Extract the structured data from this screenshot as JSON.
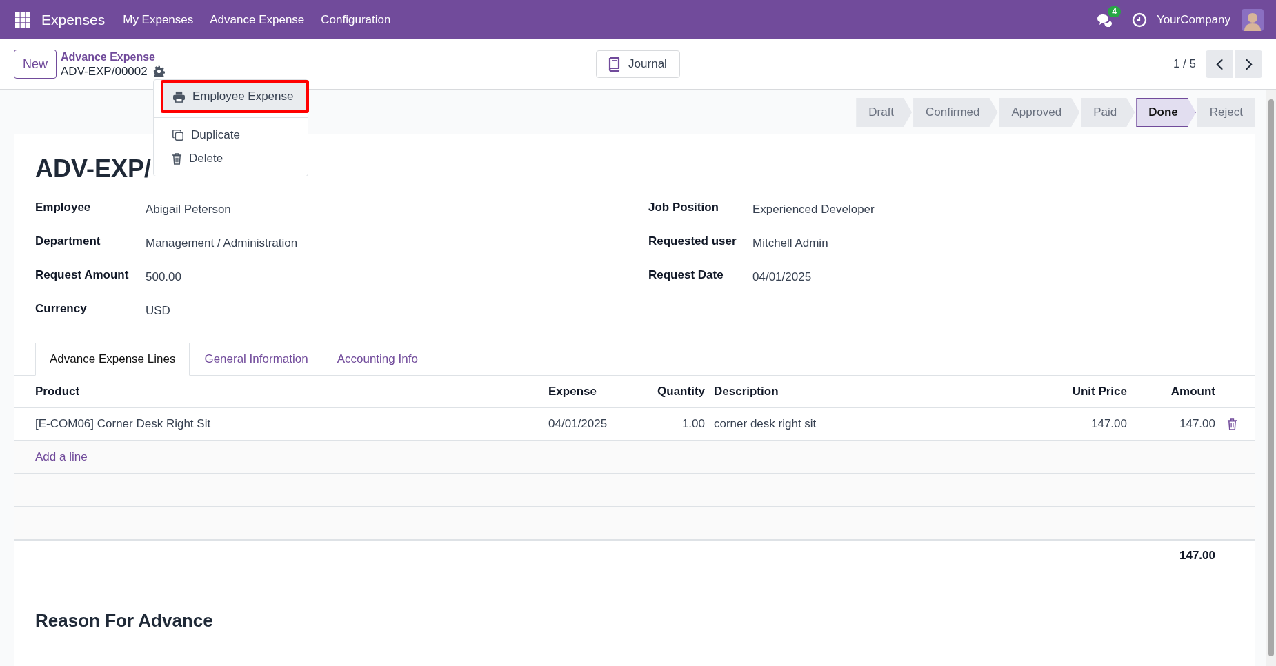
{
  "navbar": {
    "app_name": "Expenses",
    "menu": [
      "My Expenses",
      "Advance Expense",
      "Configuration"
    ],
    "messages_count": "4",
    "company": "YourCompany"
  },
  "control_panel": {
    "new_button": "New",
    "breadcrumb": "Advance Expense",
    "record_name": "ADV-EXP/00002",
    "journal_button": "Journal",
    "pager": "1 / 5"
  },
  "action_menu": {
    "items": [
      {
        "label": "Employee Expense",
        "kind": "print",
        "highlighted": true
      },
      {
        "label": "Duplicate",
        "kind": "duplicate",
        "highlighted": false
      },
      {
        "label": "Delete",
        "kind": "delete",
        "highlighted": false
      }
    ]
  },
  "status_bar": {
    "stages": [
      {
        "label": "Draft",
        "selected": false
      },
      {
        "label": "Confirmed",
        "selected": false
      },
      {
        "label": "Approved",
        "selected": false
      },
      {
        "label": "Paid",
        "selected": false
      },
      {
        "label": "Done",
        "selected": true
      },
      {
        "label": "Reject",
        "selected": false
      }
    ]
  },
  "form": {
    "title": "ADV-EXP/",
    "fields_left": [
      {
        "label": "Employee",
        "value": "Abigail Peterson"
      },
      {
        "label": "Department",
        "value": "Management / Administration"
      },
      {
        "label": "Request Amount",
        "value": "500.00"
      },
      {
        "label": "Currency",
        "value": "USD"
      }
    ],
    "fields_right": [
      {
        "label": "Job Position",
        "value": "Experienced Developer"
      },
      {
        "label": "Requested user",
        "value": "Mitchell Admin"
      },
      {
        "label": "Request Date",
        "value": "04/01/2025"
      }
    ]
  },
  "tabs": [
    {
      "label": "Advance Expense Lines",
      "selected": true
    },
    {
      "label": "General Information",
      "selected": false
    },
    {
      "label": "Accounting Info",
      "selected": false
    }
  ],
  "lines": {
    "columns": [
      "Product",
      "Expense",
      "Quantity",
      "Description",
      "Unit Price",
      "Amount"
    ],
    "rows": [
      {
        "cells": [
          "[E-COM06] Corner Desk Right Sit",
          "04/01/2025",
          "1.00",
          "corner desk right sit",
          "147.00",
          "147.00"
        ]
      }
    ],
    "add_line": "Add a line",
    "total": "147.00"
  },
  "reason_heading": "Reason For Advance"
}
